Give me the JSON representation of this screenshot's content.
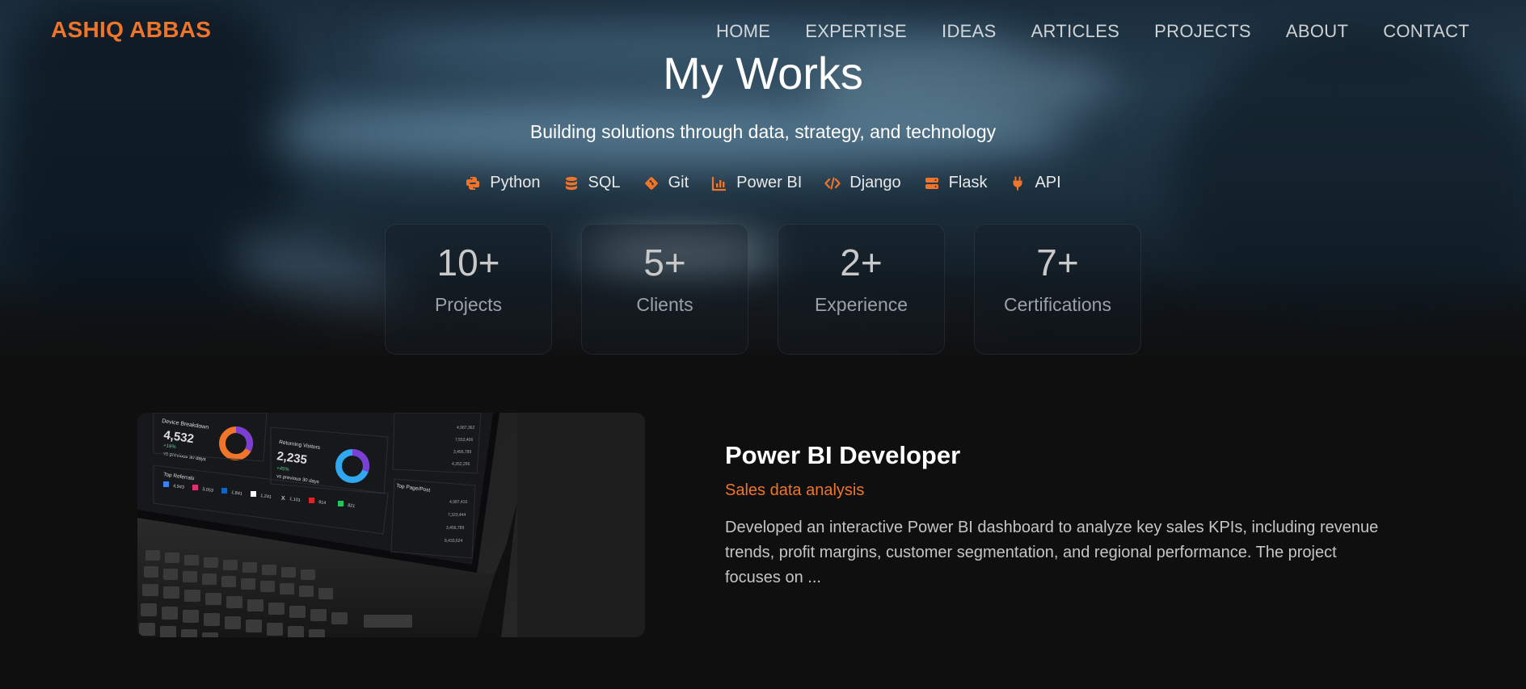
{
  "brand": {
    "name": "ASHIQ ABBAS",
    "accent": "#f0752b"
  },
  "nav": [
    {
      "label": "HOME"
    },
    {
      "label": "EXPERTISE"
    },
    {
      "label": "IDEAS"
    },
    {
      "label": "ARTICLES"
    },
    {
      "label": "PROJECTS"
    },
    {
      "label": "ABOUT"
    },
    {
      "label": "CONTACT"
    }
  ],
  "hero": {
    "title": "My Works",
    "subtitle": "Building solutions through data, strategy, and technology",
    "tech": [
      {
        "label": "Python",
        "icon": "python-icon"
      },
      {
        "label": "SQL",
        "icon": "database-icon"
      },
      {
        "label": "Git",
        "icon": "git-icon"
      },
      {
        "label": "Power BI",
        "icon": "chart-icon"
      },
      {
        "label": "Django",
        "icon": "code-icon"
      },
      {
        "label": "Flask",
        "icon": "server-icon"
      },
      {
        "label": "API",
        "icon": "plug-icon"
      }
    ]
  },
  "stats": [
    {
      "value": "10+",
      "label": "Projects"
    },
    {
      "value": "5+",
      "label": "Clients"
    },
    {
      "value": "2+",
      "label": "Experience"
    },
    {
      "value": "7+",
      "label": "Certifications"
    }
  ],
  "project": {
    "title": "Power BI Developer",
    "subtitle": "Sales data analysis",
    "description": "Developed an interactive Power BI dashboard to analyze key sales KPIs, including revenue trends, profit margins, customer segmentation, and regional performance. The project focuses on ...",
    "dashboard": {
      "device_title": "Device Breakdown",
      "device_value": "4,532",
      "device_change": "+19%",
      "device_note": "vs previous 30 days",
      "visitors_title": "Returning Visitors",
      "visitors_value": "2,235",
      "visitors_change": "+45%",
      "visitors_note": "vs previous 30 days",
      "referrals_title": "Top Referrals",
      "pages_title": "Top Page/Post",
      "referrals": [
        "4,943",
        "3,053",
        "1,841",
        "1,241",
        "1,101",
        "914",
        "821"
      ],
      "right_values": [
        "4,987,362",
        "7,553,406",
        "3,456,789",
        "4,352,256"
      ],
      "page_values": [
        "4,987,410",
        "7,323,444",
        "3,456,789",
        "8,433,624"
      ]
    }
  }
}
